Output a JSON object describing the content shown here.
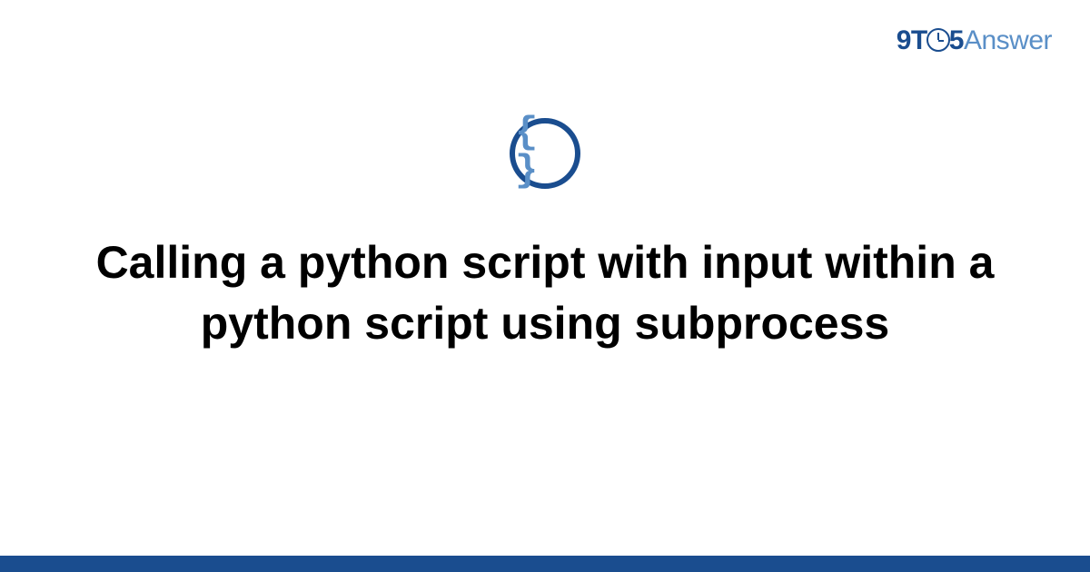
{
  "logo": {
    "prefix": "9T",
    "suffix": "5",
    "word": "Answer"
  },
  "badge": {
    "glyph": "{ }"
  },
  "title": "Calling a python script with input within a python script using subprocess",
  "colors": {
    "brand_dark": "#1a4d8f",
    "brand_light": "#5a8fc7"
  }
}
